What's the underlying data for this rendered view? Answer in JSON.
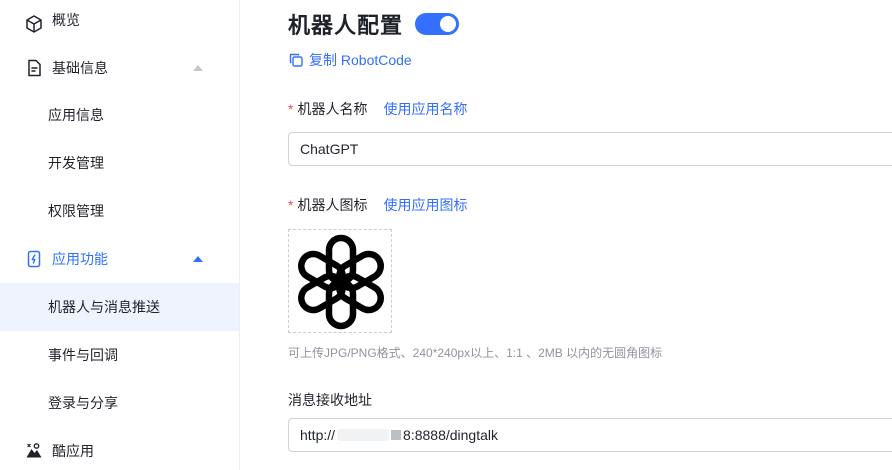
{
  "sidebar": {
    "items": [
      {
        "label": "概览",
        "icon": "cube-icon"
      },
      {
        "label": "基础信息",
        "icon": "document-icon"
      },
      {
        "label": "应用信息"
      },
      {
        "label": "开发管理"
      },
      {
        "label": "权限管理"
      },
      {
        "label": "应用功能",
        "icon": "phone-bolt-icon"
      },
      {
        "label": "机器人与消息推送"
      },
      {
        "label": "事件与回调"
      },
      {
        "label": "登录与分享"
      },
      {
        "label": "酷应用",
        "icon": "cool-app-icon"
      }
    ]
  },
  "main": {
    "title": "机器人配置",
    "toggle_on": true,
    "copy_link": "复制 RobotCode",
    "robot_name": {
      "required_mark": "*",
      "label": "机器人名称",
      "link": "使用应用名称",
      "value": "ChatGPT"
    },
    "robot_icon": {
      "required_mark": "*",
      "label": "机器人图标",
      "link": "使用应用图标",
      "hint": "可上传JPG/PNG格式、240*240px以上、1:1 、2MB 以内的无圆角图标"
    },
    "message_url": {
      "label": "消息接收地址",
      "value_prefix": "http://",
      "value_suffix": "8:8888/dingtalk"
    }
  },
  "colors": {
    "accent": "#3370ff",
    "active_bg": "#eef3fd",
    "required": "#f54a45"
  }
}
